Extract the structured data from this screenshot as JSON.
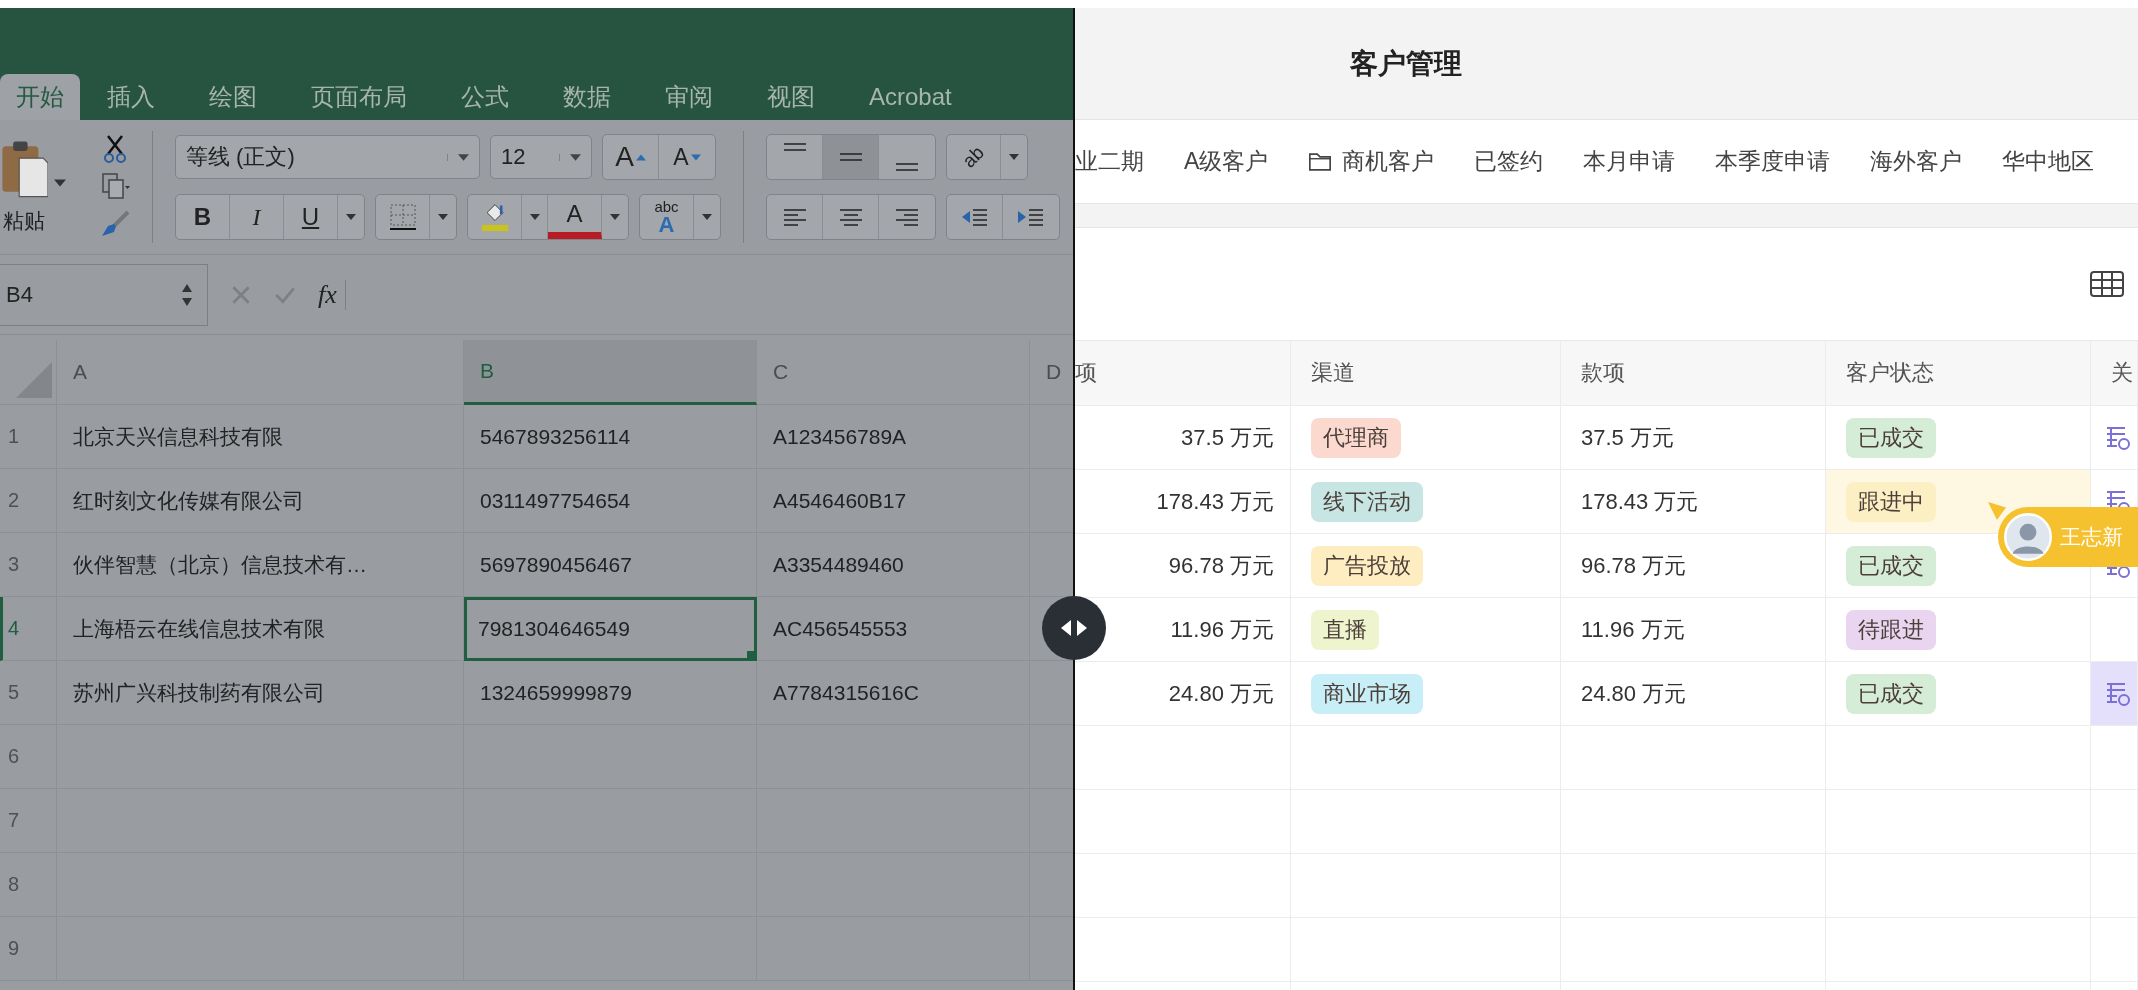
{
  "excel": {
    "tabs": [
      {
        "label": "开始",
        "selected": true
      },
      {
        "label": "插入",
        "selected": false
      },
      {
        "label": "绘图",
        "selected": false
      },
      {
        "label": "页面布局",
        "selected": false
      },
      {
        "label": "公式",
        "selected": false
      },
      {
        "label": "数据",
        "selected": false
      },
      {
        "label": "审阅",
        "selected": false
      },
      {
        "label": "视图",
        "selected": false
      },
      {
        "label": "Acrobat",
        "selected": false
      }
    ],
    "ribbon": {
      "paste_label": "粘贴",
      "font_name": "等线 (正文)",
      "font_size": "12",
      "grow_font": "A",
      "shrink_font": "A",
      "bold": "B",
      "italic": "I",
      "underline": "U",
      "font_color": "A",
      "style_top": "abc",
      "style_bottom": "A",
      "orientation": "ab"
    },
    "vertical_align": [
      {
        "selected": false
      },
      {
        "selected": true
      },
      {
        "selected": false
      }
    ],
    "formula_bar": {
      "name_box": "B4",
      "fx": "fx"
    },
    "columns": [
      {
        "label": "A",
        "selected": false
      },
      {
        "label": "B",
        "selected": true
      },
      {
        "label": "C",
        "selected": false
      },
      {
        "label": "D",
        "selected": false
      }
    ],
    "rows": [
      {
        "number": "1",
        "selected": false,
        "cells": [
          {
            "text": "北京天兴信息科技有限",
            "active": false
          },
          {
            "text": "5467893256114",
            "active": false
          },
          {
            "text": "A123456789A",
            "active": false
          }
        ]
      },
      {
        "number": "2",
        "selected": false,
        "cells": [
          {
            "text": "红时刻文化传媒有限公司",
            "active": false
          },
          {
            "text": "0311497754654",
            "active": false
          },
          {
            "text": "A4546460B17",
            "active": false
          }
        ]
      },
      {
        "number": "3",
        "selected": false,
        "cells": [
          {
            "text": "伙伴智慧（北京）信息技术有…",
            "active": false
          },
          {
            "text": "5697890456467",
            "active": false
          },
          {
            "text": "A3354489460",
            "active": false
          }
        ]
      },
      {
        "number": "4",
        "selected": true,
        "cells": [
          {
            "text": "上海梧云在线信息技术有限",
            "active": false
          },
          {
            "text": "7981304646549",
            "active": true
          },
          {
            "text": "AC456545553",
            "active": false
          }
        ]
      },
      {
        "number": "5",
        "selected": false,
        "cells": [
          {
            "text": "苏州广兴科技制药有限公司",
            "active": false
          },
          {
            "text": "1324659999879",
            "active": false
          },
          {
            "text": "A7784315616C",
            "active": false
          }
        ]
      },
      {
        "number": "6",
        "selected": false
      },
      {
        "number": "7",
        "selected": false
      },
      {
        "number": "8",
        "selected": false
      },
      {
        "number": "9",
        "selected": false
      }
    ]
  },
  "app": {
    "title": "客户管理",
    "views": [
      {
        "label": "业二期",
        "kind": "plain"
      },
      {
        "label": "A级客户",
        "kind": "plain"
      },
      {
        "label": "商机客户",
        "kind": "folder"
      },
      {
        "label": "已签约",
        "kind": "plain"
      },
      {
        "label": "本月申请",
        "kind": "plain"
      },
      {
        "label": "本季度申请",
        "kind": "plain"
      },
      {
        "label": "海外客户",
        "kind": "plain"
      },
      {
        "label": "华中地区",
        "kind": "plain"
      }
    ],
    "table": {
      "columns": [
        "项",
        "渠道",
        "款项",
        "客户状态",
        "关"
      ],
      "rows": [
        {
          "amount": "37.5 万元",
          "channel": {
            "label": "代理商",
            "color": "#fcd9cf"
          },
          "payment": "37.5 万元",
          "status": {
            "label": "已成交",
            "color": "#d5ecd6"
          },
          "status_highlighted": false,
          "linked": true,
          "link_selected": false
        },
        {
          "amount": "178.43 万元",
          "channel": {
            "label": "线下活动",
            "color": "#c6e5e3"
          },
          "payment": "178.43 万元",
          "status": {
            "label": "跟进中",
            "color": "#fdefc4"
          },
          "status_highlighted": true,
          "linked": true,
          "link_selected": false
        },
        {
          "amount": "96.78 万元",
          "channel": {
            "label": "广告投放",
            "color": "#fdedc0"
          },
          "payment": "96.78 万元",
          "status": {
            "label": "已成交",
            "color": "#d5ecd6"
          },
          "status_highlighted": false,
          "linked": true,
          "link_selected": false
        },
        {
          "amount": "11.96 万元",
          "channel": {
            "label": "直播",
            "color": "#eef4cd"
          },
          "payment": "11.96 万元",
          "status": {
            "label": "待跟进",
            "color": "#e9d5ef"
          },
          "status_highlighted": false,
          "linked": false,
          "link_selected": false
        },
        {
          "amount": "24.80 万元",
          "channel": {
            "label": "商业市场",
            "color": "#c8eef7"
          },
          "payment": "24.80 万元",
          "status": {
            "label": "已成交",
            "color": "#d5ecd6"
          },
          "status_highlighted": false,
          "linked": true,
          "link_selected": true
        }
      ]
    },
    "collaborator": {
      "name": "王志新"
    }
  }
}
